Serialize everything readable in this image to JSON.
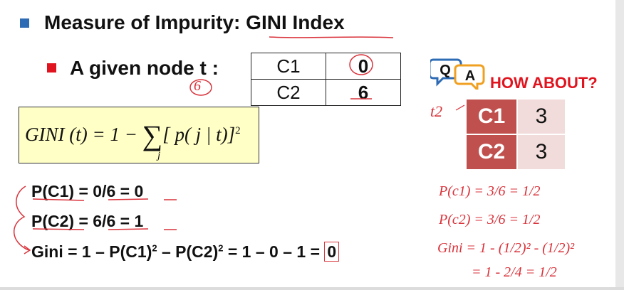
{
  "title": {
    "prefix": "Measure of Impurity: ",
    "highlight": "GINI Index"
  },
  "node": {
    "label": "A given node t :",
    "rows": [
      {
        "class": "C1",
        "count": "0"
      },
      {
        "class": "C2",
        "count": "6"
      }
    ]
  },
  "formula": {
    "lhs": "GINI (t) = 1 − ",
    "sigma": "∑",
    "sub": "j",
    "body": "[ p( j | t)]",
    "power": "2"
  },
  "calc": {
    "line1": "P(C1) = 0/6 = 0",
    "line2": "P(C2) = 6/6 = 1",
    "line3_prefix": "Gini = 1 – P(C1)",
    "line3_mid": " – P(C2)",
    "line3_rest": " = 1 – 0 – 1 = ",
    "line3_result": "0",
    "sq": "2"
  },
  "qa_icon": {
    "q": "Q",
    "a": "A"
  },
  "how_about": {
    "label": "HOW ABOUT?",
    "rows": [
      {
        "class": "C1",
        "count": "3"
      },
      {
        "class": "C2",
        "count": "3"
      }
    ]
  },
  "handwriting": {
    "node_count": "6",
    "t2_label": "t2",
    "p1": "P(c1) = 3/6 = 1/2",
    "p2": "P(c2) = 3/6 = 1/2",
    "gini1": "Gini = 1 - (1/2)² - (1/2)²",
    "gini2": "= 1 - 2/4 = 1/2"
  },
  "colors": {
    "accent_blue": "#2e6bb5",
    "bullet_red": "#e0141e",
    "ink_red": "#d9323a",
    "table_header": "#c0504d",
    "table_cell": "#f2dcdb",
    "formula_bg": "#ffffc6"
  }
}
